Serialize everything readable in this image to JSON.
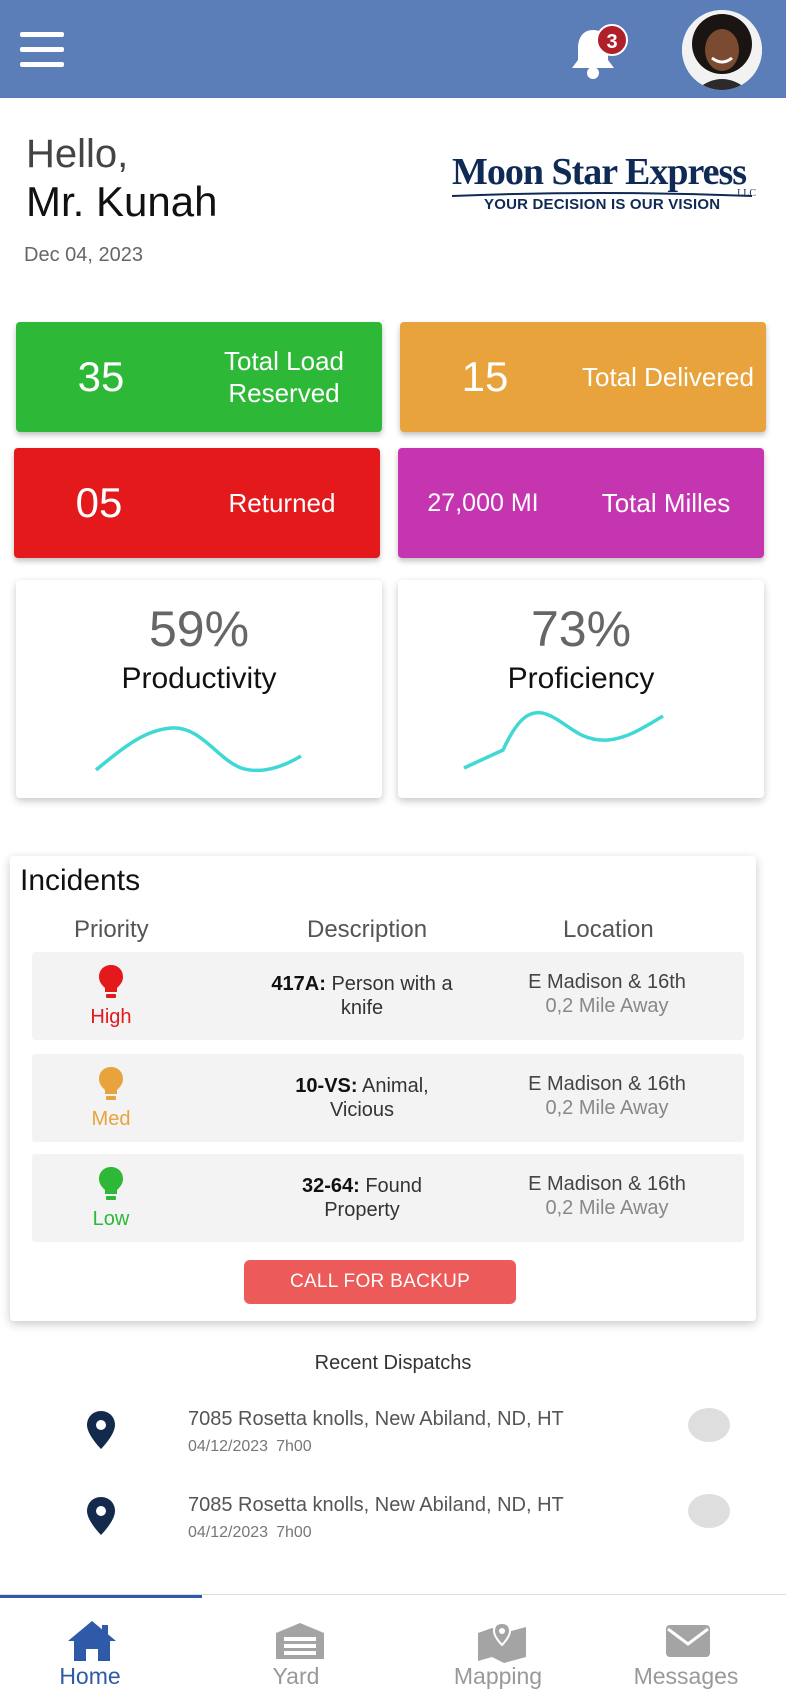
{
  "header": {
    "notification_count": "3",
    "bar_color": "#5b7db8"
  },
  "greeting": {
    "hello": "Hello,",
    "name": "Mr. Kunah",
    "date": "Dec 04, 2023"
  },
  "logo": {
    "name": "Moon Star Express",
    "suffix": "LLC",
    "tagline": "YOUR DECISION IS OUR VISION"
  },
  "stats": [
    {
      "value": "35",
      "label": "Total Load Reserved",
      "color": "#2db838"
    },
    {
      "value": "15",
      "label": "Total Delivered",
      "color": "#e8a33d"
    },
    {
      "value": "05",
      "label": "Returned",
      "color": "#e3191c"
    },
    {
      "value": "27,000 MI",
      "label": "Total Milles",
      "color": "#c535b0"
    }
  ],
  "kpis": [
    {
      "percent": "59%",
      "label": "Productivity",
      "sparkline_color": "#3fd8d4"
    },
    {
      "percent": "73%",
      "label": "Proficiency",
      "sparkline_color": "#3fd8d4"
    }
  ],
  "incidents": {
    "title": "Incidents",
    "columns": [
      "Priority",
      "Description",
      "Location"
    ],
    "rows": [
      {
        "priority": "High",
        "priority_color": "#e3191c",
        "code": "417A:",
        "description": "Person with a knife",
        "location": "E Madison & 16th",
        "distance": "0,2 Mile Away"
      },
      {
        "priority": "Med",
        "priority_color": "#e8a33d",
        "code": "10-VS:",
        "description": "Animal, Vicious",
        "location": "E Madison & 16th",
        "distance": "0,2 Mile Away"
      },
      {
        "priority": "Low",
        "priority_color": "#2db838",
        "code": "32-64:",
        "description": "Found Property",
        "location": "E Madison & 16th",
        "distance": "0,2 Mile Away"
      }
    ],
    "backup_button": "CALL FOR BACKUP"
  },
  "recent_dispatches": {
    "title": "Recent Dispatchs",
    "items": [
      {
        "address": "7085 Rosetta knolls, New Abiland, ND, HT",
        "date": "04/12/2023",
        "time": "7h00"
      },
      {
        "address": "7085 Rosetta knolls, New Abiland, ND, HT",
        "date": "04/12/2023",
        "time": "7h00"
      }
    ]
  },
  "tabs": [
    {
      "label": "Home",
      "icon": "home-icon",
      "active": true
    },
    {
      "label": "Yard",
      "icon": "garage-icon",
      "active": false
    },
    {
      "label": "Mapping",
      "icon": "map-icon",
      "active": false
    },
    {
      "label": "Messages",
      "icon": "envelope-icon",
      "active": false
    }
  ],
  "colors": {
    "accent": "#2f5aa8",
    "logo_navy": "#0f2a55",
    "backup_button": "#ec5a5a"
  }
}
